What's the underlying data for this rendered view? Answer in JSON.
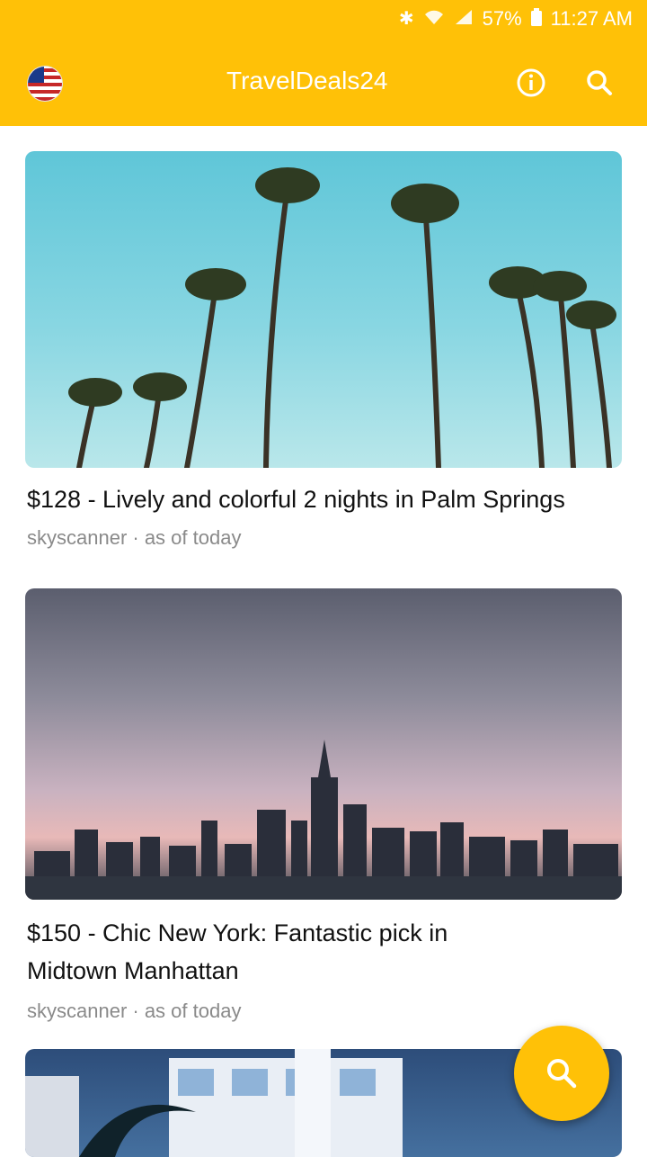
{
  "status_bar": {
    "battery": "57%",
    "time": "11:27 AM",
    "icons": [
      "bluetooth-icon",
      "wifi-icon",
      "signal-icon",
      "battery-icon"
    ]
  },
  "app_bar": {
    "flag_icon": "us-flag-icon",
    "title": "TravelDeals24",
    "actions": [
      "info-icon",
      "search-icon"
    ],
    "background": "#ffc107"
  },
  "deals": [
    {
      "title": "$128 - Lively and colorful 2 nights in Palm Springs",
      "source": "skyscanner · as of today",
      "image": "palm-trees-sky"
    },
    {
      "title": "$150 - Chic New York: Fantastic pick in Midtown Manhattan",
      "source": "skyscanner · as of today",
      "image": "new-york-skyline-sunset"
    },
    {
      "image": "art-deco-hotel-night"
    }
  ],
  "fab": {
    "icon": "search-icon"
  }
}
